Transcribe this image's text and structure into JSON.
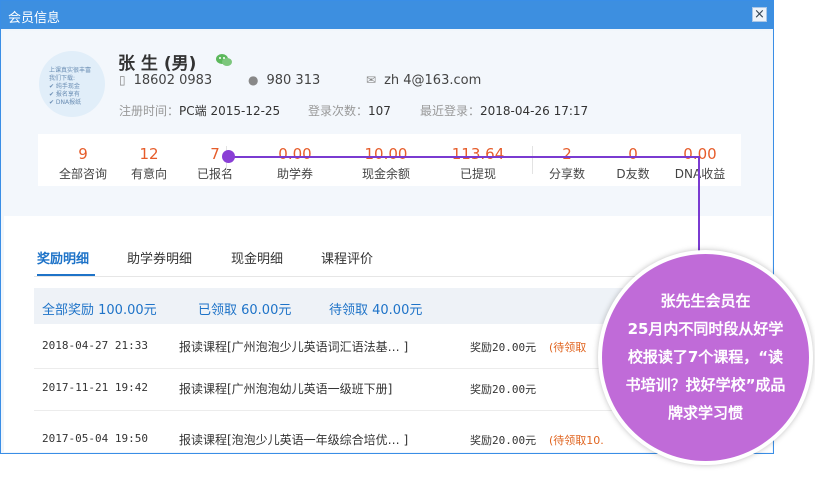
{
  "window": {
    "title": "会员信息",
    "close_label": "×"
  },
  "avatar": {
    "text": "上课真实很丰富\n我们下载:\n✔ 纯手现金\n✔ 报名享有\n✔ DNA报纸"
  },
  "profile": {
    "name": "张 生 (男)",
    "phone": "18602 0983",
    "qq": "980 313",
    "email": "zh 4@163.com",
    "register_label": "注册时间：",
    "register_value": "PC端 2015-12-25",
    "login_label": "登录次数：",
    "login_value": "107",
    "last_login_label": "最近登录：",
    "last_login_value": "2018-04-26 17:17"
  },
  "stats": [
    {
      "value": "9",
      "label": "全部咨询"
    },
    {
      "value": "12",
      "label": "有意向"
    },
    {
      "value": "7",
      "label": "已报名"
    },
    {
      "value": "0.00",
      "label": "助学券"
    },
    {
      "value": "10.00",
      "label": "现金余额"
    },
    {
      "value": "113.64",
      "label": "已提现"
    },
    {
      "value": "2",
      "label": "分享数"
    },
    {
      "value": "0",
      "label": "D友数"
    },
    {
      "value": "0.00",
      "label": "DNA收益"
    }
  ],
  "tabs": [
    "奖励明细",
    "助学券明细",
    "现金明细",
    "课程评价"
  ],
  "summary": {
    "total": "全部奖励 100.00元",
    "received": "已领取 60.00元",
    "pending": "待领取 40.00元"
  },
  "rows": [
    {
      "date": "2018-04-27 21:33",
      "desc": "报读课程[广州泡泡少儿英语词汇语法基… ]",
      "amount": "奖励20.00元",
      "note": "(待领取"
    },
    {
      "date": "2017-11-21 19:42",
      "desc": "报读课程[广州泡泡幼儿英语一级班下册]",
      "amount": "奖励20.00元",
      "note": ""
    },
    {
      "date": "2017-05-04 19:50",
      "desc": "报读课程[泡泡少儿英语一年级综合培优… ]",
      "amount": "奖励20.00元",
      "note": "(待领取10."
    }
  ],
  "callout": {
    "lines": [
      "张先生会员在",
      "25月内不同时段从好学",
      "校报读了7个课程，“读",
      "书培训？找好学校”成品",
      "牌求学习惯"
    ]
  },
  "colors": {
    "accent": "#1e73c8",
    "stat_value": "#e65c2a",
    "callout": "#c06bd8",
    "connector": "#7a3bd1"
  }
}
